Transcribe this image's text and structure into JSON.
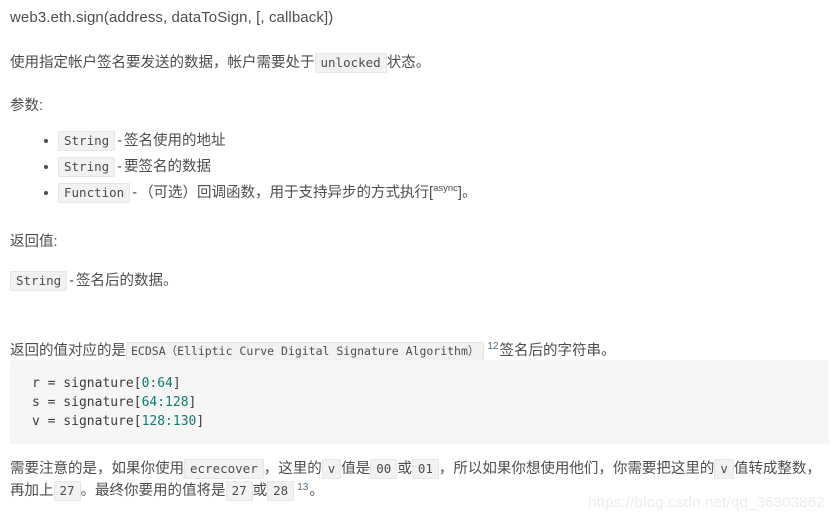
{
  "signature": {
    "text": "web3.eth.sign(address, dataToSign, [, callback])"
  },
  "description": {
    "before": "使用指定帐户签名要发送的数据，帐户需要处于",
    "code": "unlocked",
    "after": "状态。"
  },
  "params_heading": "参数:",
  "params": [
    {
      "type": "String",
      "dash": "-",
      "text": "签名使用的地址"
    },
    {
      "type": "String",
      "dash": "-",
      "text": "要签名的数据"
    },
    {
      "type": "Function",
      "dash": "-",
      "text": "（可选）回调函数，用于支持异步的方式执行[",
      "sup": "async",
      "tail": "]。"
    }
  ],
  "returns_heading": "返回值:",
  "return_value": {
    "type": "String",
    "dash": "-",
    "text": "签名后的数据。"
  },
  "ecdsa": {
    "before": "返回的值对应的是",
    "code": "ECDSA（Elliptic Curve Digital Signature Algorithm）",
    "footnote": "12",
    "after": "签名后的字符串。"
  },
  "code_block": {
    "lines": [
      {
        "prefix": "r = signature[",
        "value": "0:64",
        "suffix": "]"
      },
      {
        "prefix": "s = signature[",
        "value": "64:128",
        "suffix": "]"
      },
      {
        "prefix": "v = signature[",
        "value": "128:130",
        "suffix": "]"
      }
    ]
  },
  "note": {
    "t1": "需要注意的是，如果你使用",
    "c1": "ecrecover",
    "t2": "，这里的",
    "c2": "v",
    "t3": "值是",
    "c3": "00",
    "t4": "或",
    "c4": "01",
    "t5": "，所以如果你想使用他们，你需要把这里的",
    "c5": "v",
    "t6": "值转成整数，再加上",
    "c6": "27",
    "t7": "。最终你要用的值将是",
    "c7": "27",
    "t8": "或",
    "c8": "28",
    "footnote": "13",
    "t9": "。"
  },
  "watermark": {
    "text": "https://blog.csdn.net/qq_36303862"
  },
  "colors": {
    "text": "#4d4d4d",
    "code_bg": "#f2f2f2",
    "code_block_bg": "#f6f6f6",
    "number": "#0f7b73",
    "footnote_link": "#4a6f8a",
    "watermark": "#ededed"
  }
}
